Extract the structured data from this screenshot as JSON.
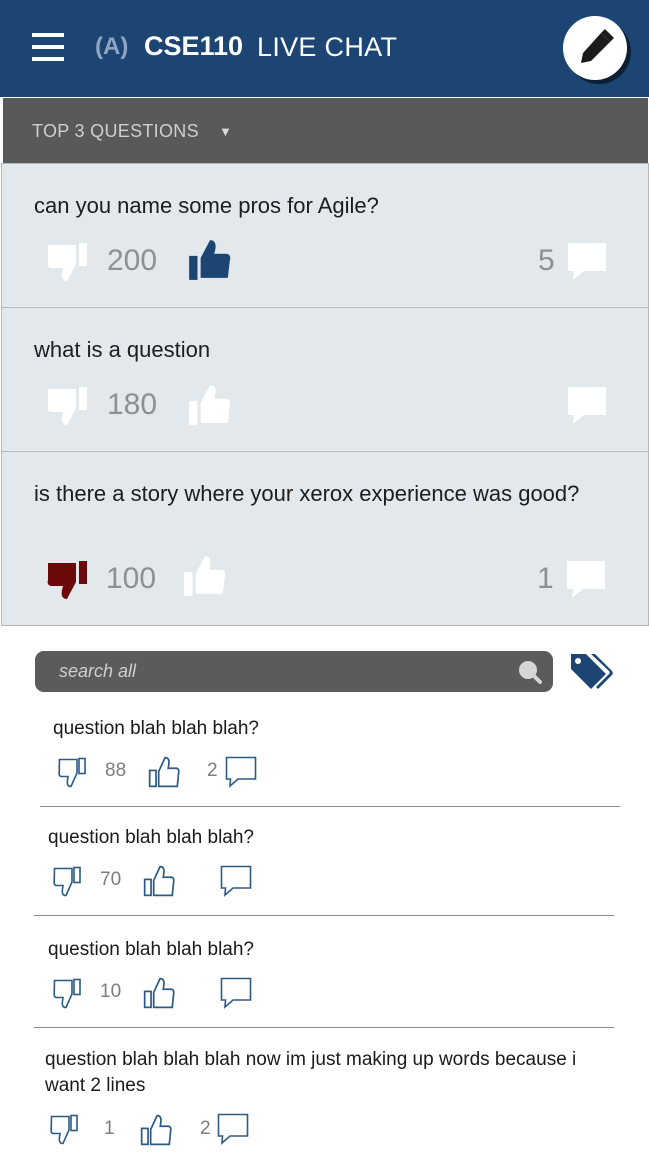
{
  "header": {
    "section": "(A)",
    "course": "CSE110",
    "title": "LIVE CHAT",
    "menu_icon": "hamburger-menu-icon",
    "compose_icon": "pencil-icon"
  },
  "top_questions": {
    "dropdown_label": "TOP 3 QUESTIONS",
    "caret": "▼",
    "items": [
      {
        "text": "can you name some pros for Agile?",
        "votes": "200",
        "comments": "5",
        "vote_state": "up"
      },
      {
        "text": "what is a question",
        "votes": "180",
        "comments": "",
        "vote_state": "none"
      },
      {
        "text": "is there a story where your xerox experience was good?",
        "votes": "100",
        "comments": "1",
        "vote_state": "down"
      }
    ]
  },
  "search": {
    "placeholder": "search all",
    "icon": "search-icon",
    "tag_icon": "tags-icon"
  },
  "questions": [
    {
      "text": "question blah blah blah?",
      "votes": "88",
      "comments": "2"
    },
    {
      "text": "question blah blah blah?",
      "votes": "70",
      "comments": ""
    },
    {
      "text": "question blah blah blah?",
      "votes": "10",
      "comments": ""
    },
    {
      "text": "question blah blah blah now im just making up words because i want 2 lines",
      "votes": "1",
      "comments": "2"
    }
  ],
  "colors": {
    "header_bg": "#1d4573",
    "card_bg": "#e2e8ec",
    "upvote_active": "#1d4573",
    "downvote_active": "#6b0a0a",
    "dropdown_bg": "#595959"
  }
}
